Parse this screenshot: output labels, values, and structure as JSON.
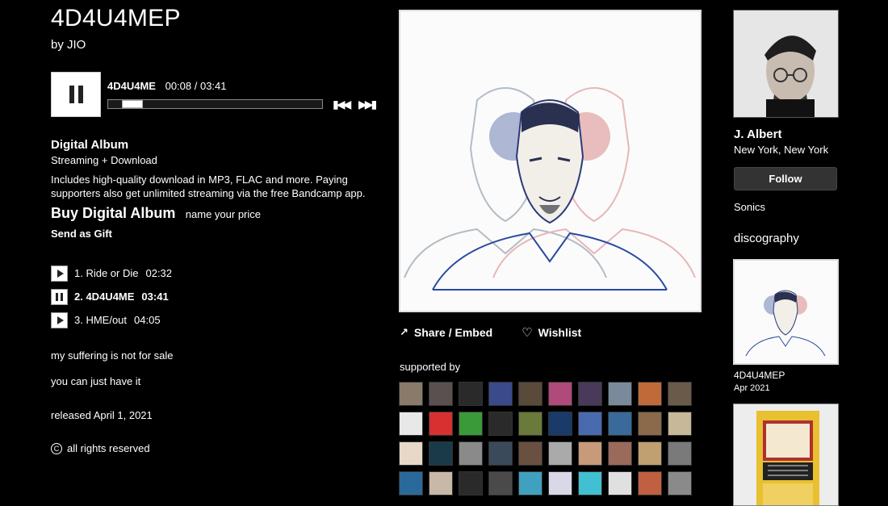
{
  "album": {
    "title": "4D4U4MEP",
    "by_prefix": "by",
    "artist": "JIO"
  },
  "player": {
    "current_track": "4D4U4ME",
    "current_time": "00:08 / 03:41",
    "progress": 0.036
  },
  "purchase": {
    "format_title": "Digital Album",
    "format_sub": "Streaming + Download",
    "description": "Includes high-quality download in MP3, FLAC and more. Paying supporters also get unlimited streaming via the free Bandcamp app.",
    "buy_label": "Buy Digital Album",
    "price_note": "name your price",
    "gift_label": "Send as Gift"
  },
  "tracks": [
    {
      "label": "1. Ride or Die",
      "duration": "02:32",
      "state": "play"
    },
    {
      "label": "2. 4D4U4ME",
      "duration": "03:41",
      "state": "pause"
    },
    {
      "label": "3. HME/out",
      "duration": "04:05",
      "state": "play"
    }
  ],
  "about": {
    "line1": "my suffering is not for sale",
    "line2": "you can just have it"
  },
  "released": "released April 1, 2021",
  "rights": "all rights reserved",
  "actions": {
    "share": "Share / Embed",
    "wishlist": "Wishlist"
  },
  "supported_by": "supported by",
  "supporters": [
    "#8a7a6a",
    "#5a5050",
    "#2a2a2a",
    "#3a4a8a",
    "#5a4a3a",
    "#b04a7a",
    "#4a3a5a",
    "#7a8a9a",
    "#c06a3a",
    "#6a5a4a",
    "#e8e8e8",
    "#d83030",
    "#3a9a3a",
    "#2a2a2a",
    "#6a7a3a",
    "#1a3a6a",
    "#4a6ab0",
    "#3a6a9a",
    "#8a6a4a",
    "#c8b89a",
    "#e8d8c8",
    "#1a3a4a",
    "#8a8a8a",
    "#3a4a5a",
    "#6a5040",
    "#aaaaaa",
    "#c89a7a",
    "#9a6a5a",
    "#c0a070",
    "#7a7a7a",
    "#2a6a9a",
    "#c8b8a8",
    "#2a2a2a",
    "#4a4a4a",
    "#40a0c0",
    "#d8d8e8",
    "#40c0d0",
    "#e0e0e0",
    "#c06040",
    "#8a8a8a"
  ],
  "artist_panel": {
    "name": "J. Albert",
    "location": "New York, New York",
    "follow_label": "Follow",
    "band_link": "Sonics",
    "discography_title": "discography"
  },
  "discography": [
    {
      "title": "4D4U4MEP",
      "date": "Apr 2021"
    }
  ]
}
